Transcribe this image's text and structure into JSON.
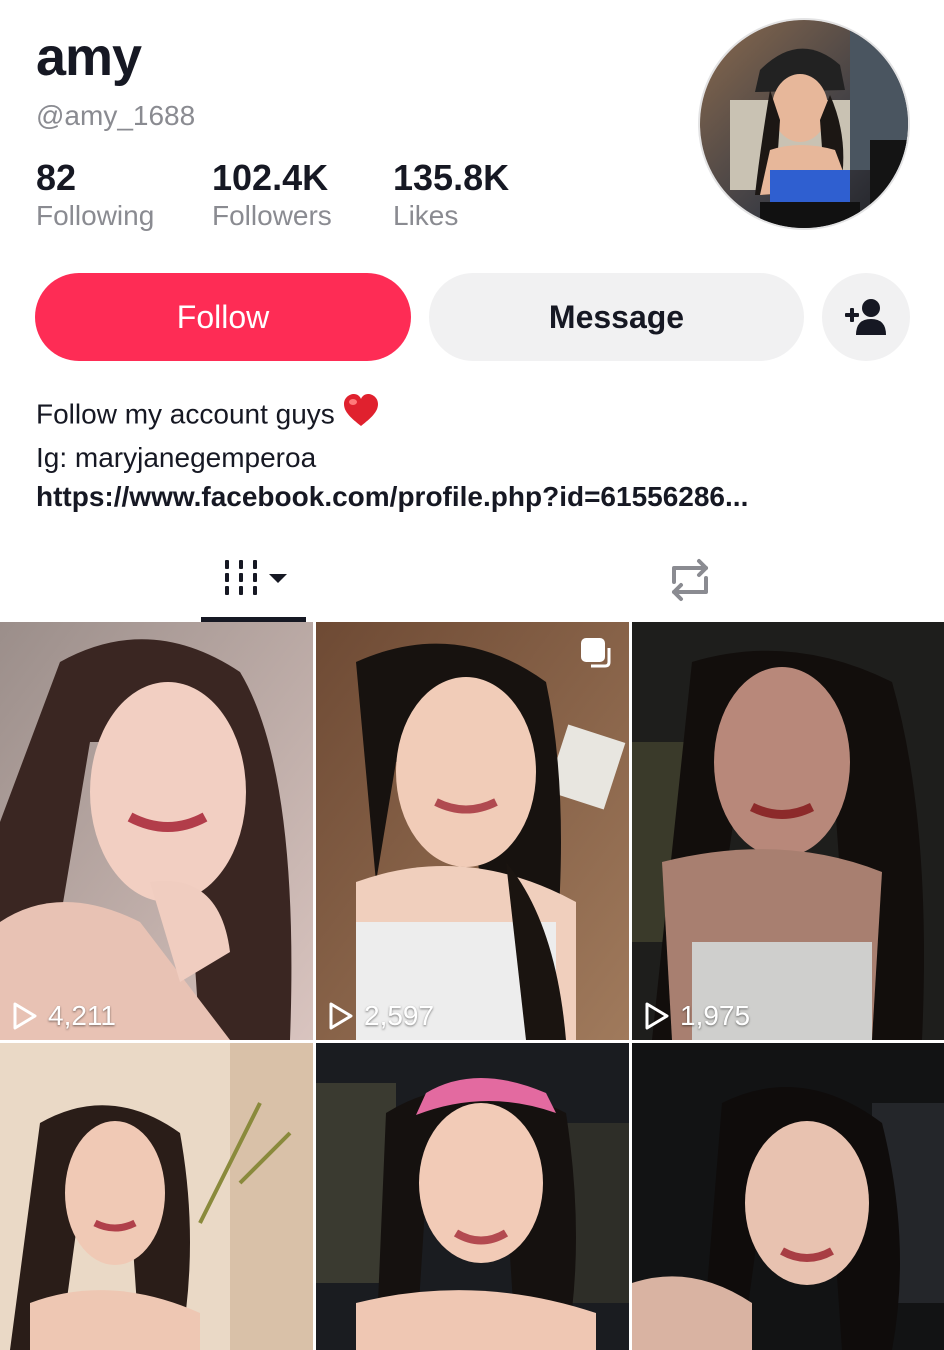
{
  "profile": {
    "display_name": "amy",
    "username": "@amy_1688",
    "avatar_icon": "avatar-photo"
  },
  "stats": [
    {
      "value": "82",
      "label": "Following"
    },
    {
      "value": "102.4K",
      "label": "Followers"
    },
    {
      "value": "135.8K",
      "label": "Likes"
    }
  ],
  "actions": {
    "follow_label": "Follow",
    "message_label": "Message",
    "add_friend_icon": "add-person-icon"
  },
  "bio": {
    "line1": "Follow my account guys",
    "line1_emoji": "heart",
    "line2": "Ig: maryjanegemperoa",
    "link": "https://www.facebook.com/profile.php?id=61556286..."
  },
  "tabs": [
    {
      "name": "videos",
      "icon": "grid-icon",
      "active": true
    },
    {
      "name": "reposts",
      "icon": "repost-icon",
      "active": false
    }
  ],
  "videos": [
    {
      "views": "4,211",
      "multi": false
    },
    {
      "views": "2,597",
      "multi": true
    },
    {
      "views": "1,975",
      "multi": false
    },
    {
      "views": "",
      "multi": false
    },
    {
      "views": "",
      "multi": false
    },
    {
      "views": "",
      "multi": false
    }
  ],
  "colors": {
    "accent": "#fe2c55",
    "secondary_bg": "#f1f1f2",
    "muted_text": "#8a8b91"
  }
}
